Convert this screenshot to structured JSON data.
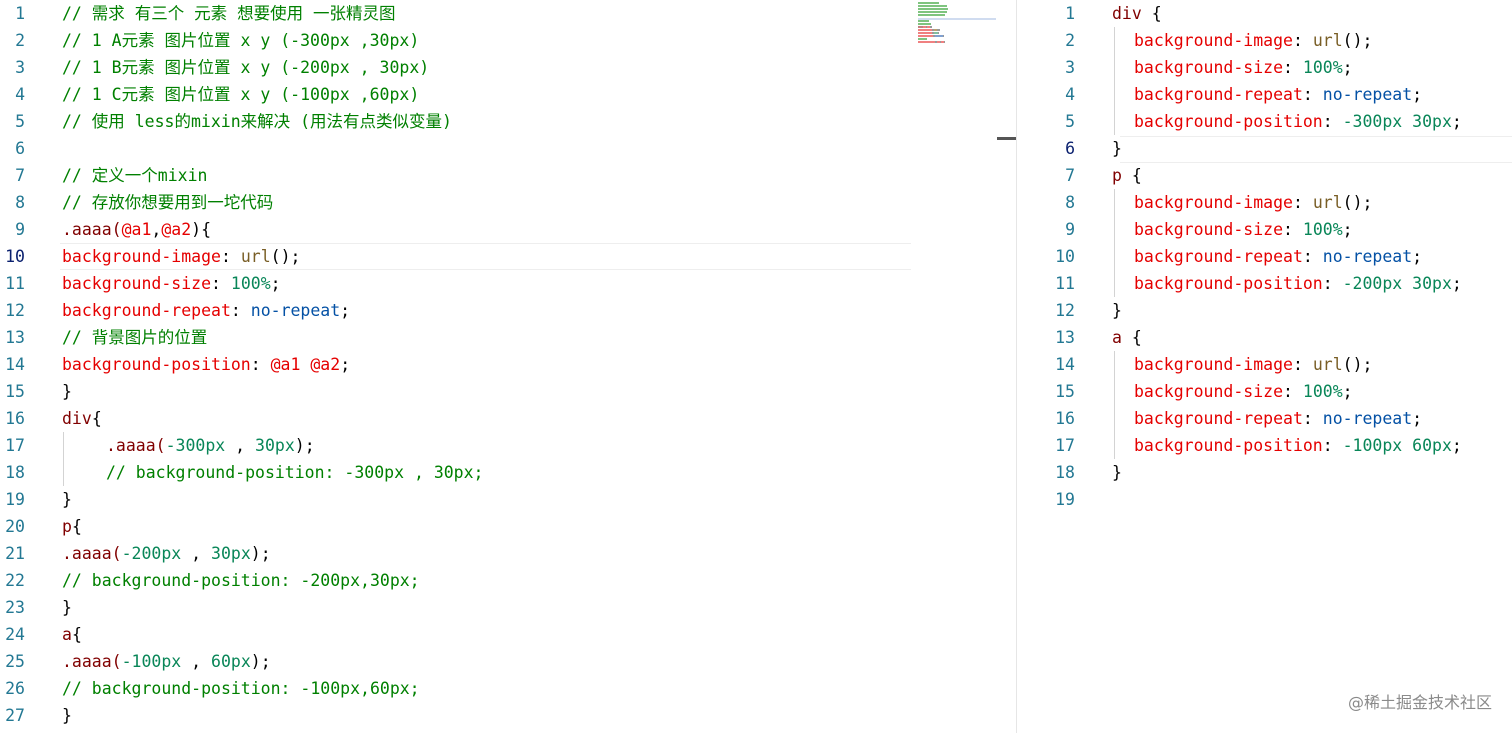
{
  "left_editor": {
    "active_line": 10,
    "lines": [
      {
        "n": "1",
        "indent": 0,
        "tokens": [
          {
            "t": "// 需求 有三个 元素 想要使用 一张精灵图",
            "c": "comment"
          }
        ]
      },
      {
        "n": "2",
        "indent": 0,
        "tokens": [
          {
            "t": "// 1 A元素 图片位置 x y (-300px ,30px)",
            "c": "comment"
          }
        ]
      },
      {
        "n": "3",
        "indent": 0,
        "tokens": [
          {
            "t": "// 1 B元素 图片位置 x y (-200px , 30px)",
            "c": "comment"
          }
        ]
      },
      {
        "n": "4",
        "indent": 0,
        "tokens": [
          {
            "t": "// 1 C元素 图片位置 x y (-100px ,60px)",
            "c": "comment"
          }
        ]
      },
      {
        "n": "5",
        "indent": 0,
        "tokens": [
          {
            "t": "// 使用 less的mixin来解决 (用法有点类似变量)",
            "c": "comment"
          }
        ]
      },
      {
        "n": "6",
        "indent": 0,
        "tokens": []
      },
      {
        "n": "7",
        "indent": 0,
        "tokens": [
          {
            "t": "// 定义一个mixin",
            "c": "comment"
          }
        ]
      },
      {
        "n": "8",
        "indent": 0,
        "tokens": [
          {
            "t": "// 存放你想要用到一坨代码",
            "c": "comment"
          }
        ]
      },
      {
        "n": "9",
        "indent": 0,
        "tokens": [
          {
            "t": ".aaaa(",
            "c": "sel"
          },
          {
            "t": "@a1",
            "c": "var"
          },
          {
            "t": ",",
            "c": "punc"
          },
          {
            "t": "@a2",
            "c": "var"
          },
          {
            "t": "){",
            "c": "punc"
          }
        ]
      },
      {
        "n": "10",
        "indent": 0,
        "tokens": [
          {
            "t": "background-image",
            "c": "prop"
          },
          {
            "t": ": ",
            "c": "punc"
          },
          {
            "t": "url",
            "c": "fn"
          },
          {
            "t": "();",
            "c": "punc"
          }
        ]
      },
      {
        "n": "11",
        "indent": 0,
        "tokens": [
          {
            "t": "background-size",
            "c": "prop"
          },
          {
            "t": ": ",
            "c": "punc"
          },
          {
            "t": "100%",
            "c": "num"
          },
          {
            "t": ";",
            "c": "punc"
          }
        ]
      },
      {
        "n": "12",
        "indent": 0,
        "tokens": [
          {
            "t": "background-repeat",
            "c": "prop"
          },
          {
            "t": ": ",
            "c": "punc"
          },
          {
            "t": "no-repeat",
            "c": "val"
          },
          {
            "t": ";",
            "c": "punc"
          }
        ]
      },
      {
        "n": "13",
        "indent": 0,
        "tokens": [
          {
            "t": "// 背景图片的位置",
            "c": "comment"
          }
        ]
      },
      {
        "n": "14",
        "indent": 0,
        "tokens": [
          {
            "t": "background-position",
            "c": "prop"
          },
          {
            "t": ": ",
            "c": "punc"
          },
          {
            "t": "@a1",
            "c": "var"
          },
          {
            "t": " ",
            "c": "punc"
          },
          {
            "t": "@a2",
            "c": "var"
          },
          {
            "t": ";",
            "c": "punc"
          }
        ]
      },
      {
        "n": "15",
        "indent": 0,
        "tokens": [
          {
            "t": "}",
            "c": "punc"
          }
        ]
      },
      {
        "n": "16",
        "indent": 0,
        "tokens": [
          {
            "t": "div",
            "c": "sel"
          },
          {
            "t": "{",
            "c": "punc"
          }
        ]
      },
      {
        "n": "17",
        "indent": 1,
        "tokens": [
          {
            "t": ".aaaa(",
            "c": "sel"
          },
          {
            "t": "-300px",
            "c": "num"
          },
          {
            "t": " , ",
            "c": "punc"
          },
          {
            "t": "30px",
            "c": "num"
          },
          {
            "t": ");",
            "c": "punc"
          }
        ]
      },
      {
        "n": "18",
        "indent": 1,
        "tokens": [
          {
            "t": "// background-position: -300px , 30px;",
            "c": "comment"
          }
        ]
      },
      {
        "n": "19",
        "indent": 0,
        "tokens": [
          {
            "t": "}",
            "c": "punc"
          }
        ]
      },
      {
        "n": "20",
        "indent": 0,
        "tokens": [
          {
            "t": "p",
            "c": "sel"
          },
          {
            "t": "{",
            "c": "punc"
          }
        ]
      },
      {
        "n": "21",
        "indent": 0,
        "tokens": [
          {
            "t": ".aaaa(",
            "c": "sel"
          },
          {
            "t": "-200px",
            "c": "num"
          },
          {
            "t": " , ",
            "c": "punc"
          },
          {
            "t": "30px",
            "c": "num"
          },
          {
            "t": ");",
            "c": "punc"
          }
        ]
      },
      {
        "n": "22",
        "indent": 0,
        "tokens": [
          {
            "t": "// background-position: -200px,30px;",
            "c": "comment"
          }
        ]
      },
      {
        "n": "23",
        "indent": 0,
        "tokens": [
          {
            "t": "}",
            "c": "punc"
          }
        ]
      },
      {
        "n": "24",
        "indent": 0,
        "tokens": [
          {
            "t": "a",
            "c": "sel"
          },
          {
            "t": "{",
            "c": "punc"
          }
        ]
      },
      {
        "n": "25",
        "indent": 0,
        "tokens": [
          {
            "t": ".aaaa(",
            "c": "sel"
          },
          {
            "t": "-100px",
            "c": "num"
          },
          {
            "t": " , ",
            "c": "punc"
          },
          {
            "t": "60px",
            "c": "num"
          },
          {
            "t": ");",
            "c": "punc"
          }
        ]
      },
      {
        "n": "26",
        "indent": 0,
        "tokens": [
          {
            "t": "// background-position: -100px,60px;",
            "c": "comment"
          }
        ]
      },
      {
        "n": "27",
        "indent": 0,
        "tokens": [
          {
            "t": "}",
            "c": "punc"
          }
        ]
      }
    ]
  },
  "right_editor": {
    "active_line": 6,
    "lines": [
      {
        "n": "1",
        "indent": 0,
        "tokens": [
          {
            "t": "div",
            "c": "sel"
          },
          {
            "t": " {",
            "c": "punc"
          }
        ]
      },
      {
        "n": "2",
        "indent": 1,
        "tokens": [
          {
            "t": "background-image",
            "c": "prop"
          },
          {
            "t": ": ",
            "c": "punc"
          },
          {
            "t": "url",
            "c": "fn"
          },
          {
            "t": "();",
            "c": "punc"
          }
        ]
      },
      {
        "n": "3",
        "indent": 1,
        "tokens": [
          {
            "t": "background-size",
            "c": "prop"
          },
          {
            "t": ": ",
            "c": "punc"
          },
          {
            "t": "100%",
            "c": "num"
          },
          {
            "t": ";",
            "c": "punc"
          }
        ]
      },
      {
        "n": "4",
        "indent": 1,
        "tokens": [
          {
            "t": "background-repeat",
            "c": "prop"
          },
          {
            "t": ": ",
            "c": "punc"
          },
          {
            "t": "no-repeat",
            "c": "val"
          },
          {
            "t": ";",
            "c": "punc"
          }
        ]
      },
      {
        "n": "5",
        "indent": 1,
        "tokens": [
          {
            "t": "background-position",
            "c": "prop"
          },
          {
            "t": ": ",
            "c": "punc"
          },
          {
            "t": "-300px 30px",
            "c": "num"
          },
          {
            "t": ";",
            "c": "punc"
          }
        ]
      },
      {
        "n": "6",
        "indent": 0,
        "tokens": [
          {
            "t": "}",
            "c": "punc"
          }
        ]
      },
      {
        "n": "7",
        "indent": 0,
        "tokens": [
          {
            "t": "p",
            "c": "sel"
          },
          {
            "t": " {",
            "c": "punc"
          }
        ]
      },
      {
        "n": "8",
        "indent": 1,
        "tokens": [
          {
            "t": "background-image",
            "c": "prop"
          },
          {
            "t": ": ",
            "c": "punc"
          },
          {
            "t": "url",
            "c": "fn"
          },
          {
            "t": "();",
            "c": "punc"
          }
        ]
      },
      {
        "n": "9",
        "indent": 1,
        "tokens": [
          {
            "t": "background-size",
            "c": "prop"
          },
          {
            "t": ": ",
            "c": "punc"
          },
          {
            "t": "100%",
            "c": "num"
          },
          {
            "t": ";",
            "c": "punc"
          }
        ]
      },
      {
        "n": "10",
        "indent": 1,
        "tokens": [
          {
            "t": "background-repeat",
            "c": "prop"
          },
          {
            "t": ": ",
            "c": "punc"
          },
          {
            "t": "no-repeat",
            "c": "val"
          },
          {
            "t": ";",
            "c": "punc"
          }
        ]
      },
      {
        "n": "11",
        "indent": 1,
        "tokens": [
          {
            "t": "background-position",
            "c": "prop"
          },
          {
            "t": ": ",
            "c": "punc"
          },
          {
            "t": "-200px 30px",
            "c": "num"
          },
          {
            "t": ";",
            "c": "punc"
          }
        ]
      },
      {
        "n": "12",
        "indent": 0,
        "tokens": [
          {
            "t": "}",
            "c": "punc"
          }
        ]
      },
      {
        "n": "13",
        "indent": 0,
        "tokens": [
          {
            "t": "a",
            "c": "sel"
          },
          {
            "t": " {",
            "c": "punc"
          }
        ]
      },
      {
        "n": "14",
        "indent": 1,
        "tokens": [
          {
            "t": "background-image",
            "c": "prop"
          },
          {
            "t": ": ",
            "c": "punc"
          },
          {
            "t": "url",
            "c": "fn"
          },
          {
            "t": "();",
            "c": "punc"
          }
        ]
      },
      {
        "n": "15",
        "indent": 1,
        "tokens": [
          {
            "t": "background-size",
            "c": "prop"
          },
          {
            "t": ": ",
            "c": "punc"
          },
          {
            "t": "100%",
            "c": "num"
          },
          {
            "t": ";",
            "c": "punc"
          }
        ]
      },
      {
        "n": "16",
        "indent": 1,
        "tokens": [
          {
            "t": "background-repeat",
            "c": "prop"
          },
          {
            "t": ": ",
            "c": "punc"
          },
          {
            "t": "no-repeat",
            "c": "val"
          },
          {
            "t": ";",
            "c": "punc"
          }
        ]
      },
      {
        "n": "17",
        "indent": 1,
        "tokens": [
          {
            "t": "background-position",
            "c": "prop"
          },
          {
            "t": ": ",
            "c": "punc"
          },
          {
            "t": "-100px 60px",
            "c": "num"
          },
          {
            "t": ";",
            "c": "punc"
          }
        ]
      },
      {
        "n": "18",
        "indent": 0,
        "tokens": [
          {
            "t": "}",
            "c": "punc"
          }
        ]
      },
      {
        "n": "19",
        "indent": 0,
        "tokens": []
      }
    ]
  },
  "watermark": "@稀土掘金技术社区",
  "colors": {
    "comment": "#008000",
    "property": "#e50000",
    "value": "#0451a5",
    "number": "#098658",
    "selector": "#800000",
    "line_number": "#237893",
    "line_number_active": "#0b216f"
  }
}
